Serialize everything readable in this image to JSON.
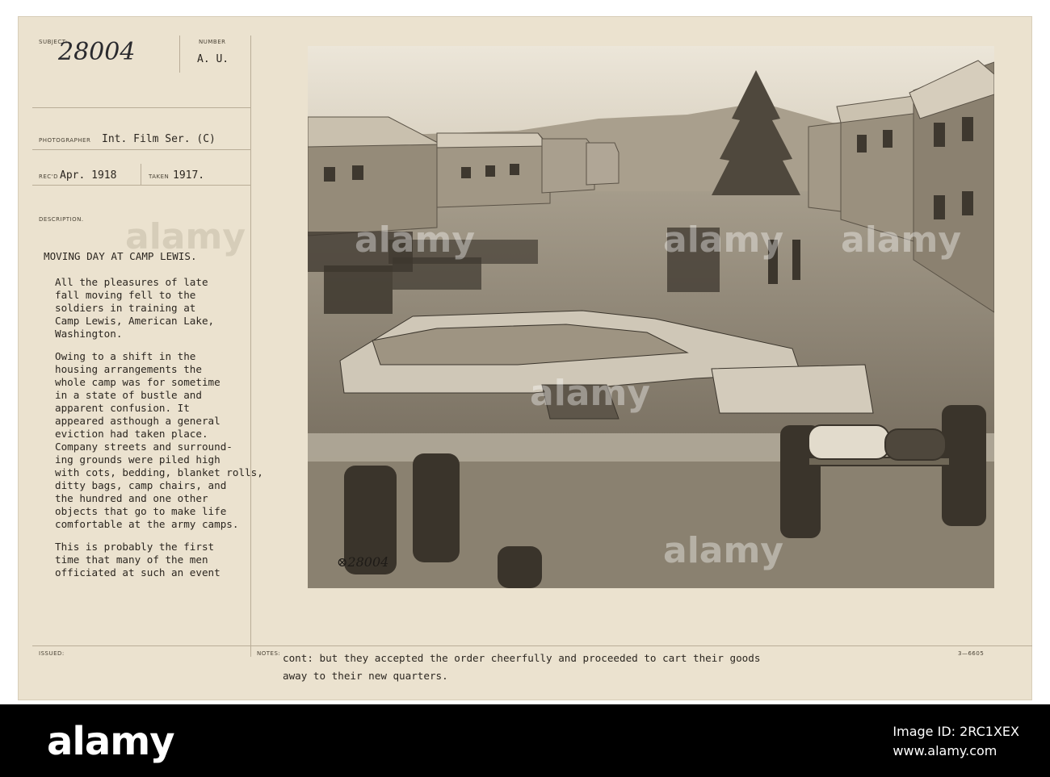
{
  "header": {
    "subject_label": "SUBJECT:",
    "subject_value": "28004",
    "number_label": "NUMBER",
    "number_value": "A. U.",
    "photographer_label": "PHOTOGRAPHER",
    "photographer_value": "Int. Film Ser. (C)",
    "recd_label": "REC'D",
    "recd_value": "Apr. 1918",
    "taken_label": "TAKEN",
    "taken_value": "1917.",
    "description_label": "DESCRIPTION."
  },
  "description": {
    "title": "MOVING DAY AT CAMP LEWIS.",
    "para1": [
      "All the pleasures of late",
      "fall moving fell to the",
      "soldiers in training at",
      "Camp Lewis, American Lake,",
      "Washington."
    ],
    "para2": [
      "Owing to a shift in the",
      "housing arrangements the",
      "whole camp was for sometime",
      "in a state of bustle and",
      "apparent confusion.  It",
      "appeared asthough a general",
      "eviction had taken place.",
      "Company streets and surround-",
      "ing grounds were piled high",
      "with cots, bedding, blanket rolls,",
      "ditty bags, camp chairs, and",
      "the hundred and one other",
      "objects that go to make life",
      "comfortable at the army camps."
    ],
    "para3": [
      "This is probably the first",
      "time that many of the men",
      "officiated at such an event"
    ]
  },
  "footer_fields": {
    "issued_label": "ISSUED:",
    "notes_label": "NOTES:",
    "notes_line1": "cont: but they accepted the order cheerfully and proceeded to cart their goods",
    "notes_line2": "away to their new  quarters.",
    "form_code": "3—6605"
  },
  "photo": {
    "negative_number": "⊗28004",
    "watermarks": [
      "alamy",
      "alamy",
      "alamy",
      "alamy",
      "alamy"
    ]
  },
  "stock_footer": {
    "logo": "alamy",
    "image_id_label": "Image ID: 2RC1XEX",
    "site": "www.alamy.com"
  },
  "colors": {
    "card": "#ebe2cf",
    "photo_sepia": "#8f8677",
    "footer_bg": "#000000"
  }
}
